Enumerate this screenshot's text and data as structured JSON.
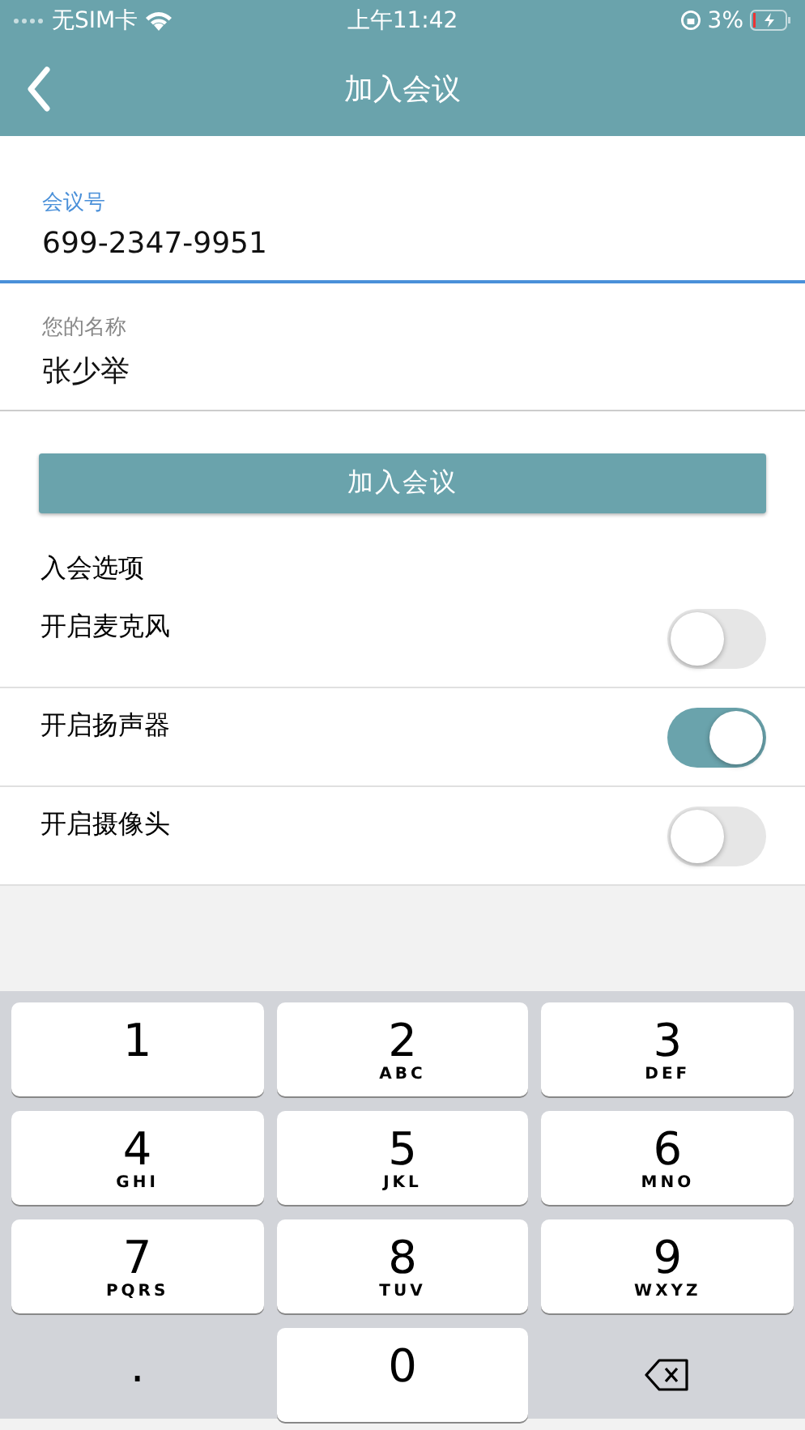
{
  "status_bar": {
    "carrier": "无SIM卡",
    "time": "上午11:42",
    "battery": "3%"
  },
  "nav": {
    "title": "加入会议"
  },
  "fields": [
    {
      "label": "会议号",
      "value": "699-2347-9951",
      "focused": true
    },
    {
      "label": "您的名称",
      "value": "张少举",
      "focused": false
    }
  ],
  "join_button": "加入会议",
  "options": {
    "title": "入会选项",
    "items": [
      {
        "label": "开启麦克风",
        "on": false
      },
      {
        "label": "开启扬声器",
        "on": true
      },
      {
        "label": "开启摄像头",
        "on": false
      }
    ]
  },
  "keypad": {
    "rows": [
      [
        {
          "kind": "digit",
          "digit": "1"
        },
        {
          "kind": "digit",
          "digit": "2",
          "letters": "ABC"
        },
        {
          "kind": "digit",
          "digit": "3",
          "letters": "DEF"
        }
      ],
      [
        {
          "kind": "digit",
          "digit": "4",
          "letters": "GHI"
        },
        {
          "kind": "digit",
          "digit": "5",
          "letters": "JKL"
        },
        {
          "kind": "digit",
          "digit": "6",
          "letters": "MNO"
        }
      ],
      [
        {
          "kind": "digit",
          "digit": "7",
          "letters": "PQRS"
        },
        {
          "kind": "digit",
          "digit": "8",
          "letters": "TUV"
        },
        {
          "kind": "digit",
          "digit": "9",
          "letters": "WXYZ"
        }
      ],
      [
        {
          "kind": "symbol",
          "digit": "."
        },
        {
          "kind": "digit",
          "digit": "0"
        },
        {
          "kind": "delete"
        }
      ]
    ]
  }
}
